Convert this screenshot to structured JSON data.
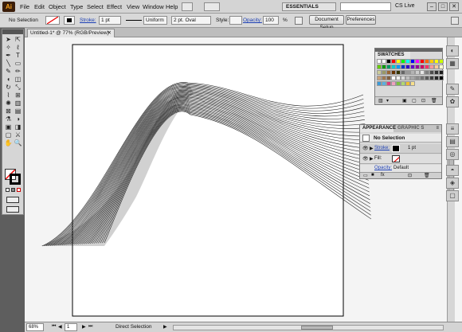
{
  "app": {
    "logo": "Ai",
    "menu": [
      "File",
      "Edit",
      "Object",
      "Type",
      "Select",
      "Effect",
      "View",
      "Window",
      "Help"
    ],
    "workspace": "ESSENTIALS",
    "cs_live": "CS Live",
    "win_min": "–",
    "win_max": "□",
    "win_close": "✕"
  },
  "control_bar": {
    "selection": "No Selection",
    "stroke_label": "Stroke:",
    "stroke_weight": "1 pt",
    "profile": "Uniform",
    "brush": "2 pt. Oval",
    "style_label": "Style:",
    "opacity_label": "Opacity:",
    "opacity_value": "100",
    "opacity_unit": "%",
    "doc_setup": "Document Setup",
    "preferences": "Preferences"
  },
  "document_tab": {
    "title": "Untitled-1* @ 77% (RGB/Preview)",
    "close": "✕"
  },
  "status_bar": {
    "zoom": "68%",
    "page": "1",
    "tool": "Direct Selection"
  },
  "swatches": {
    "tab": "SWATCHES",
    "colors": [
      [
        "#ffffff",
        "#ffffff",
        "#000000",
        "#ff0000",
        "#ffff00",
        "#00ff00",
        "#00ffff",
        "#0000ff",
        "#ff00ff",
        "#ff0000",
        "#ff6600",
        "#ffcc00",
        "#ffff00",
        "#ccff00"
      ],
      [
        "#66cc00",
        "#009900",
        "#009966",
        "#00cccc",
        "#0099ff",
        "#0033cc",
        "#3300cc",
        "#6600cc",
        "#990099",
        "#cc0066",
        "#ff3366",
        "#ff9999",
        "#ffcc99",
        "#ffffcc"
      ],
      [
        "#cccc99",
        "#999966",
        "#996633",
        "#663300",
        "#333300",
        "#666666",
        "#999999",
        "#b3b3b3",
        "#cccccc",
        "#e6e6e6",
        "#808080",
        "#4d4d4d",
        "#333333",
        "#1a1a1a"
      ],
      [
        "#c8a078",
        "#a07850",
        "#806040",
        "#ffffff",
        "#f2f2f2",
        "#d9d9d9",
        "#bfbfbf",
        "#a6a6a6",
        "#8c8c8c",
        "#737373",
        "#595959",
        "#404040",
        "#262626",
        "#000000"
      ],
      [
        "#3a9ad9",
        "#5ab0e0",
        "#e03a7a",
        "#f0a0c0",
        "#7ac040",
        "#b0d870",
        "#f0c030",
        "#f8e08a"
      ]
    ]
  },
  "appearance": {
    "tabs": [
      "APPEARANCE",
      "GRAPHIC S"
    ],
    "selection": "No Selection",
    "stroke_label": "Stroke:",
    "stroke_value": "1 pt",
    "fill_label": "Fill:",
    "opacity_label": "Opacity:",
    "opacity_value": "Default"
  },
  "artwork": {
    "line_count": 32,
    "line_color": "#1a1a1a"
  }
}
